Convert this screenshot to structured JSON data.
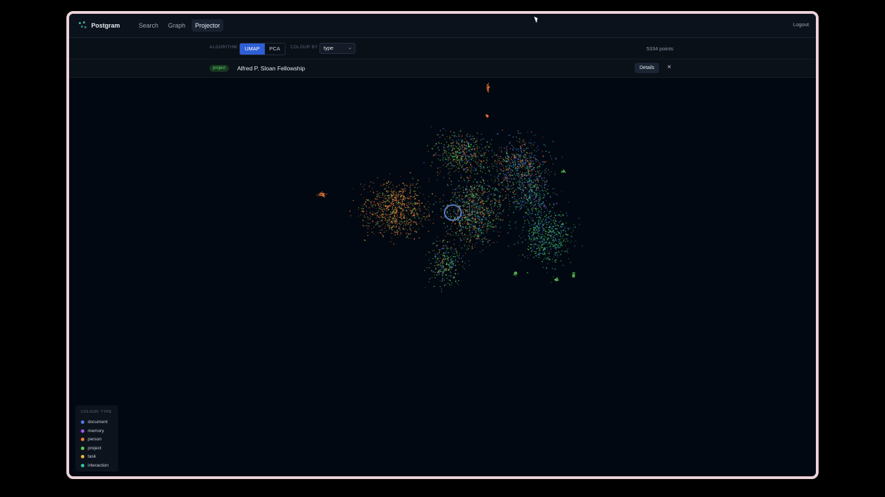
{
  "app": {
    "name": "Postgram"
  },
  "nav": {
    "items": [
      {
        "label": "Search"
      },
      {
        "label": "Graph"
      },
      {
        "label": "Projector"
      }
    ],
    "active": "Projector"
  },
  "header": {
    "logout_label": "Logout"
  },
  "toolbar": {
    "algorithm_label": "ALGORITHM",
    "algorithms": [
      {
        "label": "UMAP"
      },
      {
        "label": "PCA"
      }
    ],
    "active_algorithm": "UMAP",
    "colour_by_label": "COLOUR BY",
    "colour_by_value": "type",
    "points_count": "5334 points"
  },
  "selection": {
    "type_badge": "project",
    "title": "Alfred P. Sloan Fellowship",
    "details_label": "Details",
    "close_glyph": "×"
  },
  "legend": {
    "title": "COLOUR: TYPE",
    "items": [
      {
        "label": "document",
        "color": "#4f7cf0"
      },
      {
        "label": "memory",
        "color": "#9a5cf0"
      },
      {
        "label": "person",
        "color": "#f07a3a"
      },
      {
        "label": "project",
        "color": "#5fcc55"
      },
      {
        "label": "task",
        "color": "#e8b83a"
      },
      {
        "label": "interaction",
        "color": "#2fc4a8"
      }
    ]
  },
  "colors": {
    "accent": "#2f5fd6",
    "background": "#020811",
    "project_badge": "#5fd27a",
    "selection_ring": "#5b7fc0"
  },
  "icons": {
    "logo": "graph-logo-icon",
    "select_chevron": "chevron-down-icon",
    "close": "close-icon",
    "cursor": "mouse-cursor-icon"
  }
}
